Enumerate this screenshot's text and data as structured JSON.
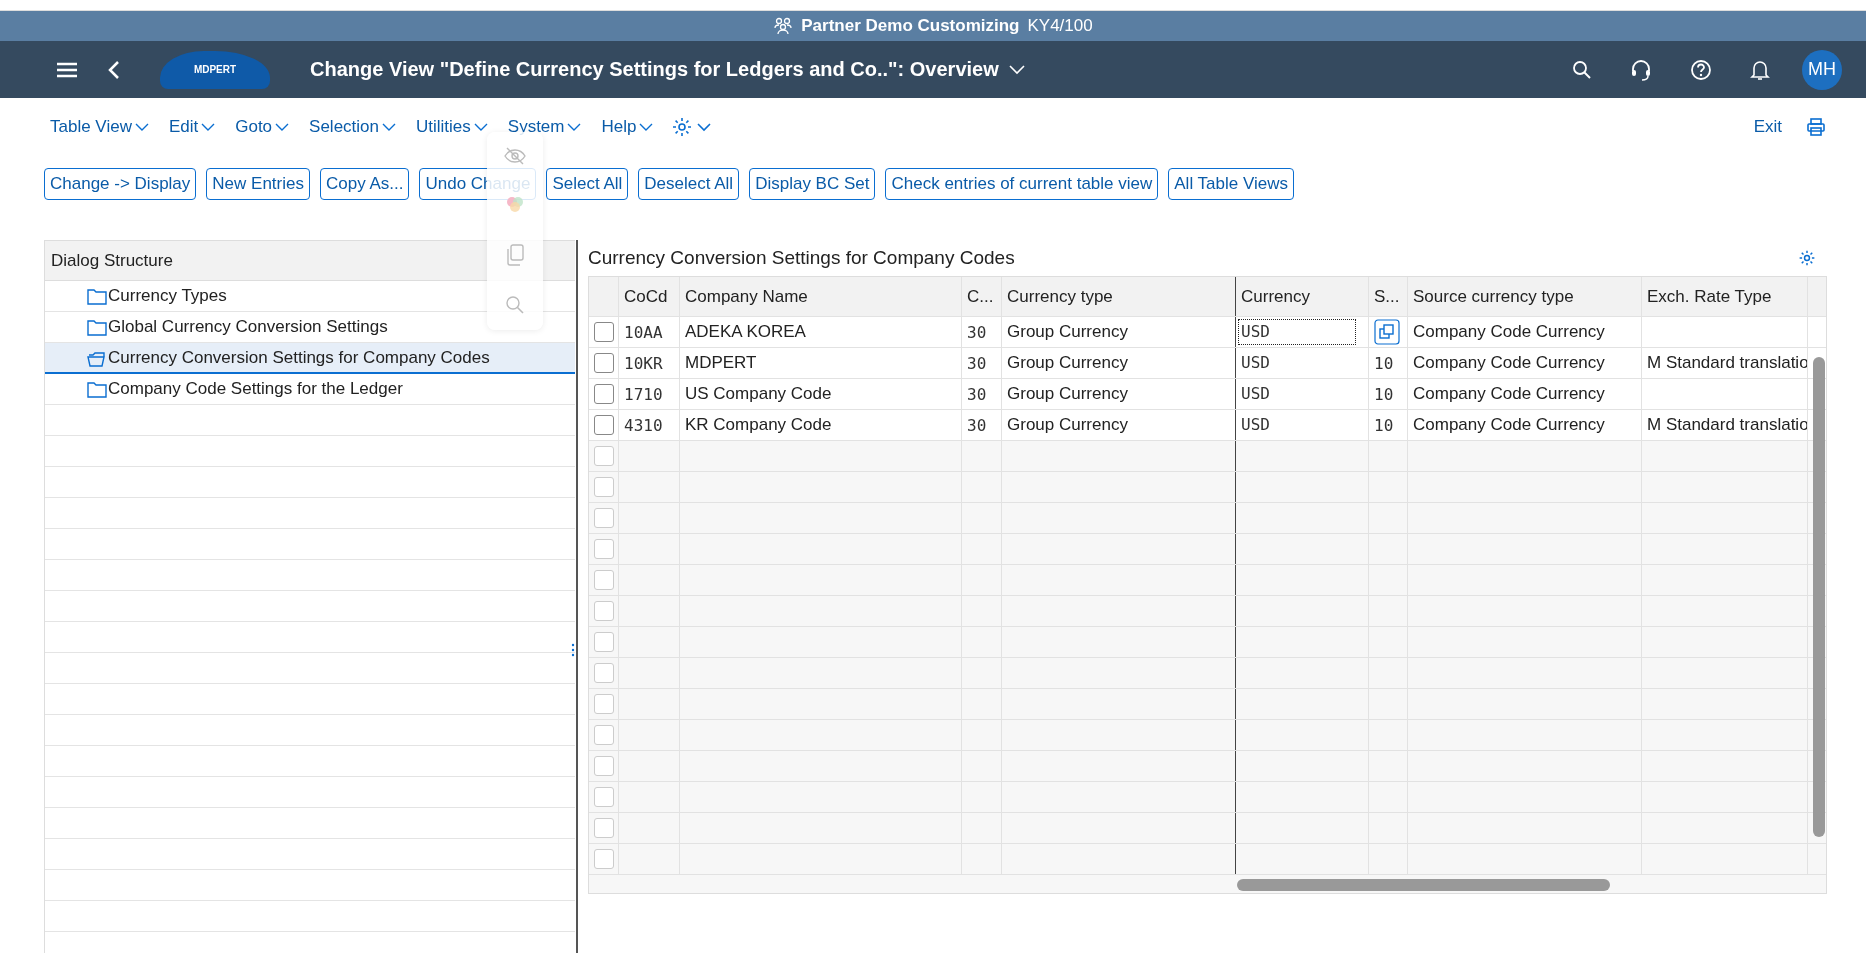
{
  "shell": {
    "system_title": "Partner Demo Customizing",
    "system_id": "KY4/100",
    "logo_text": "MDPERT",
    "title": "Change View \"Define Currency Settings for Ledgers and Co..\": Overview",
    "avatar": "MH"
  },
  "menu": [
    "Table View",
    "Edit",
    "Goto",
    "Selection",
    "Utilities",
    "System",
    "Help"
  ],
  "exit": "Exit",
  "toolbar": [
    "Change -> Display",
    "New Entries",
    "Copy As...",
    "Undo Change",
    "Select All",
    "Deselect All",
    "Display BC Set",
    "Check entries of current table view",
    "All Table Views"
  ],
  "dialog_structure": {
    "title": "Dialog Structure",
    "items": [
      {
        "label": "Currency Types",
        "selected": false
      },
      {
        "label": "Global Currency Conversion Settings",
        "selected": false
      },
      {
        "label": "Currency Conversion Settings for Company Codes",
        "selected": true
      },
      {
        "label": "Company Code Settings for the Ledger",
        "selected": false
      }
    ]
  },
  "table": {
    "title": "Currency Conversion Settings for Company Codes",
    "columns": [
      "CoCd",
      "Company Name",
      "C...",
      "Currency type",
      "Currency",
      "S...",
      "Source currency type",
      "Exch. Rate Type"
    ],
    "rows": [
      {
        "checked": false,
        "focused": true,
        "cells": [
          "10AA",
          "ADEKA KOREA",
          "30",
          "Group Currency",
          "USD",
          "",
          "Company Code Currency",
          ""
        ]
      },
      {
        "checked": false,
        "focused": false,
        "cells": [
          "10KR",
          "MDPERT",
          "30",
          "Group Currency",
          "USD",
          "10",
          "Company Code Currency",
          "M Standard translatio"
        ]
      },
      {
        "checked": false,
        "focused": false,
        "cells": [
          "1710",
          "US Company Code",
          "30",
          "Group Currency",
          "USD",
          "10",
          "Company Code Currency",
          ""
        ]
      },
      {
        "checked": false,
        "focused": false,
        "cells": [
          "4310",
          "KR Company Code",
          "30",
          "Group Currency",
          "USD",
          "10",
          "Company Code Currency",
          "M Standard translatio"
        ]
      }
    ],
    "empty_rows": [
      {
        "checked": false
      },
      {
        "checked": false
      },
      {
        "checked": false
      },
      {
        "checked": false
      },
      {
        "checked": false
      },
      {
        "checked": false
      },
      {
        "checked": false
      },
      {
        "checked": false
      },
      {
        "checked": false
      },
      {
        "checked": false
      },
      {
        "checked": false
      },
      {
        "checked": false
      },
      {
        "checked": false
      },
      {
        "checked": false
      }
    ]
  }
}
